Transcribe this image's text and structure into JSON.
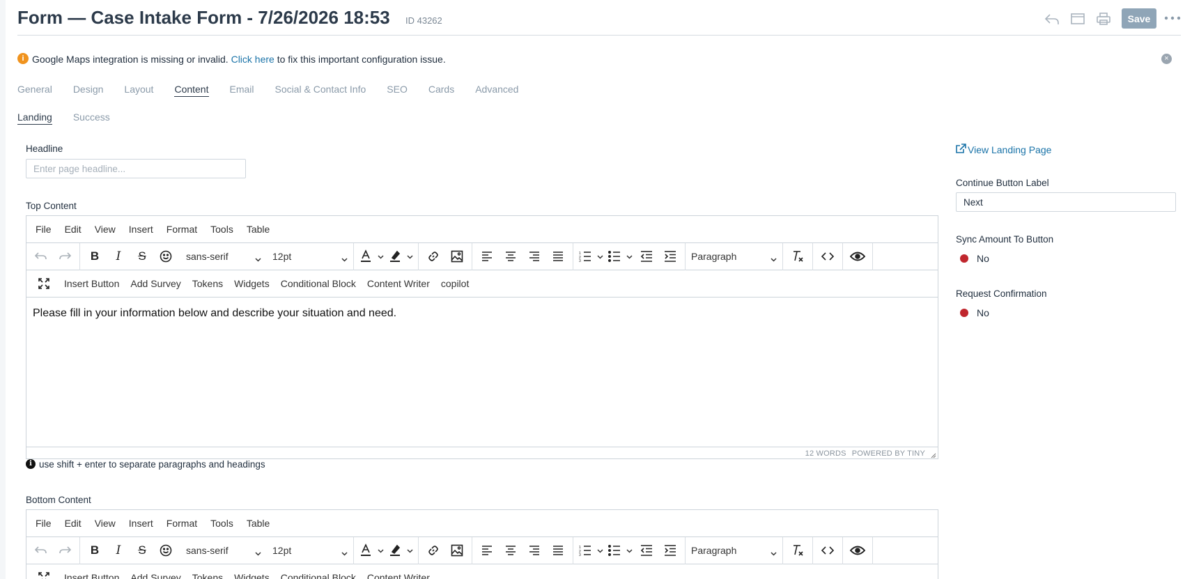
{
  "header": {
    "title": "Form — Case Intake Form - 7/26/2026 18:53",
    "id_label": "ID 43262",
    "save_label": "Save"
  },
  "alert": {
    "before": "Google Maps integration is missing or invalid. ",
    "link": "Click here",
    "after": " to fix this important configuration issue.",
    "icon": "i"
  },
  "tabs": [
    {
      "label": "General"
    },
    {
      "label": "Design"
    },
    {
      "label": "Layout"
    },
    {
      "label": "Content",
      "active": true
    },
    {
      "label": "Email"
    },
    {
      "label": "Social & Contact Info"
    },
    {
      "label": "SEO"
    },
    {
      "label": "Cards"
    },
    {
      "label": "Advanced"
    }
  ],
  "subtabs": [
    {
      "label": "Landing",
      "active": true
    },
    {
      "label": "Success"
    }
  ],
  "headline": {
    "label": "Headline",
    "placeholder": "Enter page headline..."
  },
  "editor_common": {
    "menu": [
      "File",
      "Edit",
      "View",
      "Insert",
      "Format",
      "Tools",
      "Table"
    ],
    "font_family": "sans-serif",
    "font_size": "12pt",
    "block_format": "Paragraph",
    "extras": [
      "Insert Button",
      "Add Survey",
      "Tokens",
      "Widgets",
      "Conditional Block",
      "Content Writer",
      "copilot"
    ]
  },
  "top_content": {
    "label": "Top Content",
    "text": "Please fill in your information below and describe your situation and need.",
    "word_count": "12 WORDS",
    "powered_by": "POWERED BY TINY"
  },
  "hint": {
    "icon": "i",
    "text": "use shift + enter to separate paragraphs and headings"
  },
  "bottom_content": {
    "label": "Bottom Content"
  },
  "sidebar": {
    "view_link": "View Landing Page",
    "continue_label": "Continue Button Label",
    "continue_value": "Next",
    "sync_label": "Sync Amount To Button",
    "sync_value": "No",
    "confirm_label": "Request Confirmation",
    "confirm_value": "No"
  },
  "colors": {
    "accent": "#1a73a8",
    "toggle_off": "#c0262d",
    "warning": "#f0931e",
    "save": "#8fa5b7"
  }
}
